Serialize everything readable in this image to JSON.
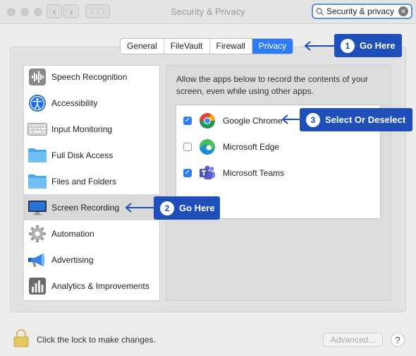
{
  "window": {
    "title": "Security & Privacy"
  },
  "nav": {
    "back": "‹",
    "forward": "›",
    "grid": "⋮⋮⋮"
  },
  "search": {
    "value": "Security & privacy",
    "clear": "✕"
  },
  "tabs": [
    {
      "label": "General"
    },
    {
      "label": "FileVault"
    },
    {
      "label": "Firewall"
    },
    {
      "label": "Privacy"
    }
  ],
  "sidebar": {
    "items": [
      {
        "label": "Speech Recognition",
        "icon": "waveform-icon"
      },
      {
        "label": "Accessibility",
        "icon": "accessibility-icon"
      },
      {
        "label": "Input Monitoring",
        "icon": "keyboard-icon"
      },
      {
        "label": "Full Disk Access",
        "icon": "folder-icon"
      },
      {
        "label": "Files and Folders",
        "icon": "folder-icon"
      },
      {
        "label": "Screen Recording",
        "icon": "display-icon"
      },
      {
        "label": "Automation",
        "icon": "gear-icon"
      },
      {
        "label": "Advertising",
        "icon": "megaphone-icon"
      },
      {
        "label": "Analytics & Improvements",
        "icon": "analytics-icon"
      }
    ]
  },
  "panel": {
    "description": "Allow the apps below to record the contents of your screen, even while using other apps.",
    "apps": [
      {
        "name": "Google Chrome",
        "checked": true,
        "icon": "chrome-icon"
      },
      {
        "name": "Microsoft Edge",
        "checked": false,
        "icon": "edge-icon"
      },
      {
        "name": "Microsoft Teams",
        "checked": true,
        "icon": "teams-icon"
      }
    ]
  },
  "footer": {
    "lock_text": "Click the lock to make changes.",
    "advanced_label": "Advanced...",
    "help_label": "?"
  },
  "callouts": [
    {
      "number": "1",
      "text": "Go Here"
    },
    {
      "number": "2",
      "text": "Go Here"
    },
    {
      "number": "3",
      "text": "Select Or Deselect"
    }
  ],
  "colors": {
    "accent": "#2d7cf6",
    "callout": "#1f4fb8"
  }
}
